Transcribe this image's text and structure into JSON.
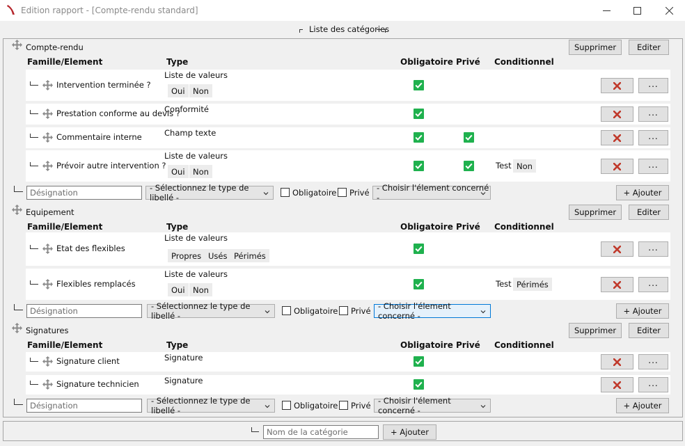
{
  "window": {
    "title": "Edition rapport - [Compte-rendu standard]"
  },
  "group_legend": "Liste des catégories",
  "headers": {
    "famille": "Famille/Element",
    "type": "Type",
    "obligatoire": "Obligatoire",
    "prive": "Privé",
    "conditionnel": "Conditionnel"
  },
  "labels": {
    "supprimer": "Supprimer",
    "editer": "Editer",
    "ajouter": "+ Ajouter",
    "designation_placeholder": "Désignation",
    "type_select": "- Sélectionnez le type de libellé -",
    "obligatoire": "Obligatoire",
    "prive": "Privé",
    "element_select": "- Choisir l'élement concerné -",
    "dots": "...",
    "test": "Test"
  },
  "categories": [
    {
      "name": "Compte-rendu",
      "items": [
        {
          "name": "Intervention terminée ?",
          "type": "Liste de valeurs",
          "values": [
            "Oui",
            "Non"
          ],
          "obligatoire": true,
          "prive": false,
          "conditionnel": null
        },
        {
          "name": "Prestation conforme au devis ?",
          "type": "Conformité",
          "values": [],
          "obligatoire": true,
          "prive": false,
          "conditionnel": null
        },
        {
          "name": "Commentaire interne",
          "type": "Champ texte",
          "values": [],
          "obligatoire": true,
          "prive": true,
          "conditionnel": null
        },
        {
          "name": "Prévoir autre intervention ?",
          "type": "Liste de valeurs",
          "values": [
            "Oui",
            "Non"
          ],
          "obligatoire": true,
          "prive": true,
          "conditionnel": "Non"
        }
      ]
    },
    {
      "name": "Equipement",
      "items": [
        {
          "name": "Etat des flexibles",
          "type": "Liste de valeurs",
          "values": [
            "Propres",
            "Usés",
            "Périmés"
          ],
          "obligatoire": true,
          "prive": false,
          "conditionnel": null
        },
        {
          "name": "Flexibles remplacés",
          "type": "Liste de valeurs",
          "values": [
            "Oui",
            "Non"
          ],
          "obligatoire": true,
          "prive": false,
          "conditionnel": "Périmés"
        }
      ]
    },
    {
      "name": "Signatures",
      "items": [
        {
          "name": "Signature client",
          "type": "Signature",
          "values": [],
          "obligatoire": true,
          "prive": false,
          "conditionnel": null
        },
        {
          "name": "Signature technicien",
          "type": "Signature",
          "values": [],
          "obligatoire": true,
          "prive": false,
          "conditionnel": null
        }
      ]
    }
  ],
  "footer": {
    "category_placeholder": "Nom de la catégorie",
    "add_label": "+ Ajouter"
  },
  "colors": {
    "check_green": "#1fb14e",
    "delete_red": "#c0392b",
    "focus_blue": "#0078d7"
  }
}
